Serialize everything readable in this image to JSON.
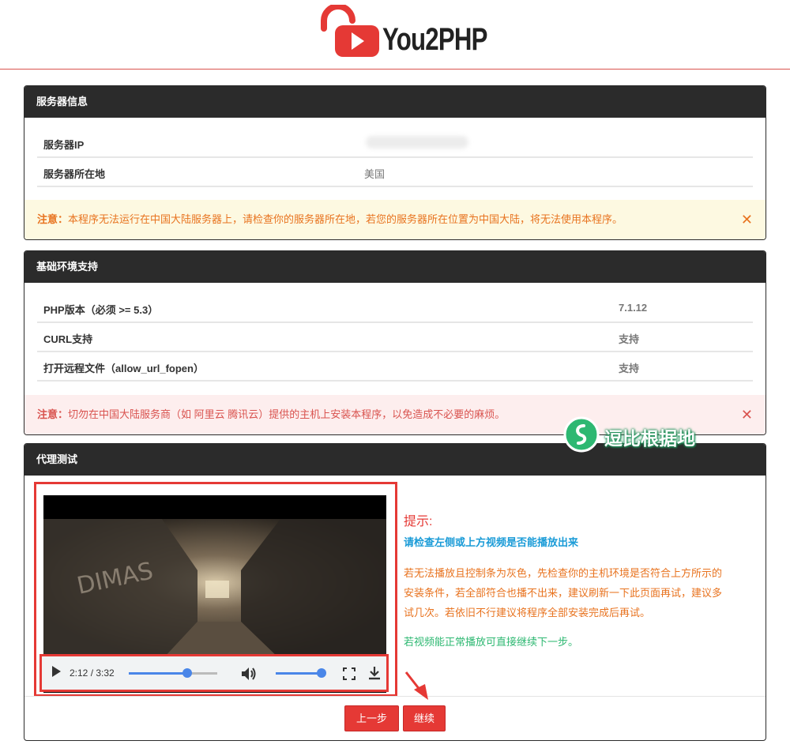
{
  "logo": {
    "text": "You2PHP"
  },
  "server_panel": {
    "title": "服务器信息",
    "rows": [
      {
        "key": "服务器IP",
        "value": ""
      },
      {
        "key": "服务器所在地",
        "value": "美国"
      }
    ],
    "notice_label": "注意：",
    "notice_text": "本程序无法运行在中国大陆服务器上，请检查你的服务器所在地，若您的服务器所在位置为中国大陆，将无法使用本程序。",
    "close_symbol": "✕"
  },
  "env_panel": {
    "title": "基础环境支持",
    "rows": [
      {
        "key": "PHP版本（必须 >= 5.3）",
        "value": "7.1.12"
      },
      {
        "key": "CURL支持",
        "value": "支持"
      },
      {
        "key": "打开远程文件（allow_url_fopen）",
        "value": "支持"
      }
    ],
    "notice_label": "注意：",
    "notice_text": "切勿在中国大陆服务商（如 阿里云 腾讯云）提供的主机上安装本程序，以免造成不必要的麻烦。",
    "close_symbol": "✕"
  },
  "watermark": {
    "text": "逗比根据地"
  },
  "proxy_panel": {
    "title": "代理测试",
    "player": {
      "time": "2:12 / 3:32",
      "progress": 0.62,
      "volume": 1.0,
      "overlay_text": "DIMAS"
    },
    "hint": {
      "title": "提示:",
      "subtitle": "请检查左侧或上方视频是否能播放出来",
      "body": "若无法播放且控制条为灰色，先检查你的主机环境是否符合上方所示的安装条件，若全部符合也播不出来，建议刷新一下此页面再试，建议多试几次。若依旧不行建议将程序全部安装完成后再试。",
      "ok": "若视频能正常播放可直接继续下一步。"
    },
    "prev_label": "上一步",
    "next_label": "继续"
  },
  "colors": {
    "brand_red": "#e53935",
    "dark": "#2b2b2b",
    "warn_text": "#e8731f",
    "danger_text": "#d9534f",
    "info_text": "#1a9bd7",
    "success_text": "#2eb872"
  }
}
